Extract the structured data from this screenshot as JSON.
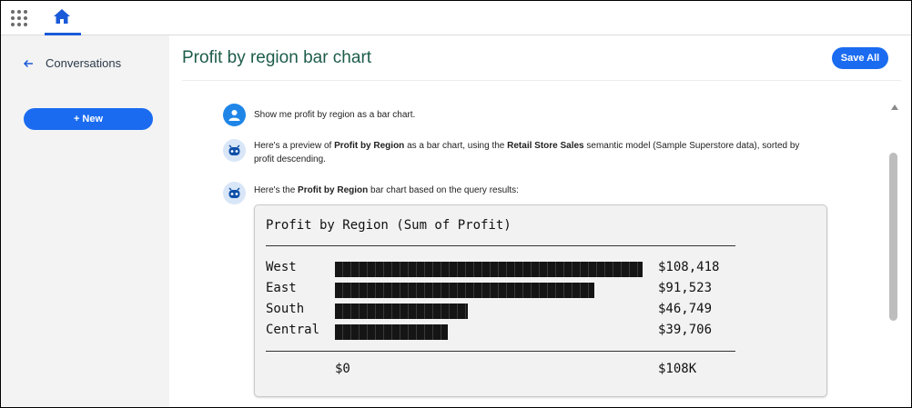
{
  "topbar": {
    "apps_icon": "grid-icon",
    "home_icon": "home-icon"
  },
  "sidebar": {
    "back_label": "Conversations",
    "new_label": "+ New"
  },
  "header": {
    "title": "Profit by region bar chart",
    "save_all_label": "Save All"
  },
  "messages": [
    {
      "role": "user",
      "text": "Show me profit by region as a bar chart."
    },
    {
      "role": "assistant",
      "parts": [
        "Here's a preview of ",
        "Profit by Region",
        " as a bar chart, using the ",
        "Retail Store Sales",
        " semantic model (Sample Superstore data), sorted by profit descending."
      ]
    },
    {
      "role": "assistant",
      "parts": [
        "Here's the ",
        "Profit by Region",
        " bar chart based on the query results:"
      ]
    }
  ],
  "text_chart": {
    "title": "Profit by Region (Sum of Profit)",
    "rows": [
      {
        "region": "West",
        "value_label": "$108,418",
        "value": 108418
      },
      {
        "region": "East",
        "value_label": "$91,523",
        "value": 91523
      },
      {
        "region": "South",
        "value_label": "$46,749",
        "value": 46749
      },
      {
        "region": "Central",
        "value_label": "$39,706",
        "value": 39706
      }
    ],
    "axis_min_label": "$0",
    "axis_max_label": "$108K",
    "axis_max": 108418
  },
  "colors": {
    "accent": "#1a6bf0",
    "title": "#1d5c4a",
    "sidebar_bg": "#f3f3f3"
  }
}
